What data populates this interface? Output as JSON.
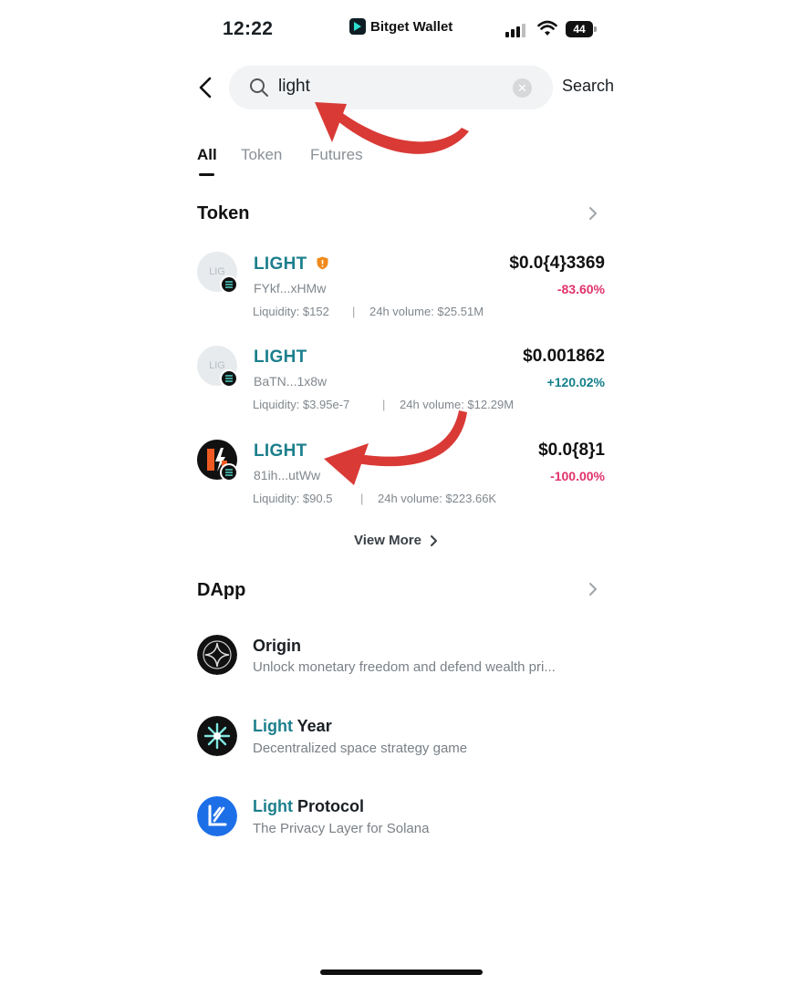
{
  "status_bar": {
    "time": "12:22",
    "carrier": "Bitget Wallet",
    "battery": "44"
  },
  "search": {
    "value": "light",
    "button_label": "Search"
  },
  "tabs": [
    {
      "label": "All",
      "active": true
    },
    {
      "label": "Token",
      "active": false
    },
    {
      "label": "Futures",
      "active": false
    }
  ],
  "token_section": {
    "title": "Token",
    "items": [
      {
        "avatar_text": "LIG",
        "name": "LIGHT",
        "warning": true,
        "address": "FYkf...xHMw",
        "price": "$0.0{4}3369",
        "change": "-83.60%",
        "change_dir": "negative",
        "liquidity": "Liquidity: $152",
        "volume": "24h volume: $25.51M"
      },
      {
        "avatar_text": "LIG",
        "name": "LIGHT",
        "warning": false,
        "address": "BaTN...1x8w",
        "price": "$0.001862",
        "change": "+120.02%",
        "change_dir": "positive",
        "liquidity": "Liquidity: $3.95e-7",
        "volume": "24h volume: $12.29M"
      },
      {
        "avatar_text": "",
        "name": "LIGHT",
        "warning": false,
        "address": "81ih...utWw",
        "price": "$0.0{8}1",
        "change": "-100.00%",
        "change_dir": "negative",
        "liquidity": "Liquidity: $90.5",
        "volume": "24h volume: $223.66K"
      }
    ],
    "view_more": "View More"
  },
  "dapp_section": {
    "title": "DApp",
    "items": [
      {
        "name_highlight": "",
        "name_rest": "Origin",
        "description": "Unlock monetary freedom and defend wealth pri...",
        "icon": "origin-icon"
      },
      {
        "name_highlight": "Light",
        "name_rest": " Year",
        "description": "Decentralized space strategy game",
        "icon": "light-year-icon"
      },
      {
        "name_highlight": "Light",
        "name_rest": " Protocol",
        "description": "The Privacy Layer for Solana",
        "icon": "light-protocol-icon"
      }
    ]
  },
  "colors": {
    "accent": "#1c7f8c",
    "negative": "#e0336b",
    "positive": "#14808c",
    "annotation_arrow": "#d93a36"
  }
}
